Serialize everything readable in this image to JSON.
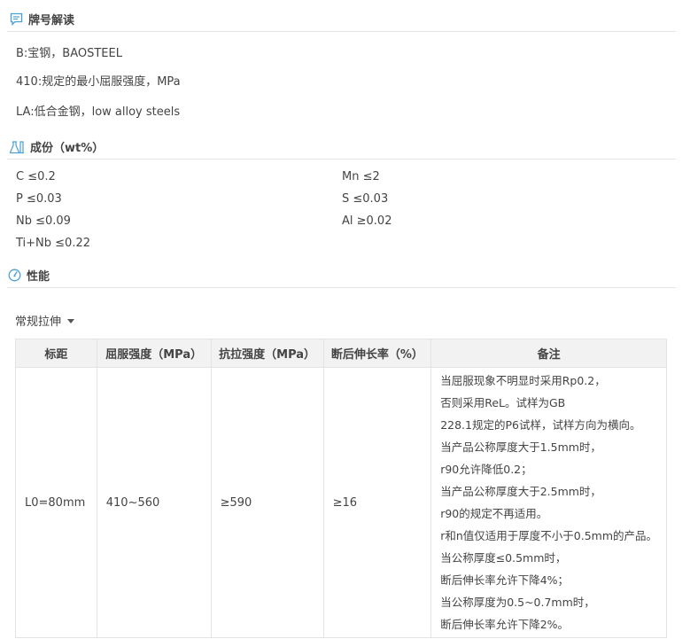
{
  "sections": {
    "designation": {
      "title": "牌号解读",
      "icon": "comment-icon"
    },
    "composition": {
      "title": "成份（wt%）",
      "icon": "flask-icon"
    },
    "properties": {
      "title": "性能",
      "icon": "gauge-icon"
    }
  },
  "designation_lines": [
    "B:宝钢，BAOSTEEL",
    "410:规定的最小屈服强度，MPa",
    "LA:低合金钢，low alloy steels"
  ],
  "composition": {
    "left": [
      "C ≤0.2",
      "P ≤0.03",
      "Nb ≤0.09",
      "Ti+Nb ≤0.22"
    ],
    "right": [
      "Mn ≤2",
      "S ≤0.03",
      "Al ≥0.02"
    ]
  },
  "test_dropdown": {
    "value": "常规拉伸"
  },
  "table": {
    "headers": [
      "标距",
      "屈服强度（MPa）",
      "抗拉强度（MPa）",
      "断后伸长率（%）",
      "备注"
    ],
    "row": {
      "gauge": "L0=80mm",
      "yield": "410~560",
      "tensile": "≥590",
      "elongation": "≥16",
      "notes": [
        "当屈服现象不明显时采用Rp0.2，",
        "否则采用ReL。试样为GB",
        "228.1规定的P6试样，试样方向为横向。",
        "当产品公称厚度大于1.5mm时，",
        "r90允许降低0.2；",
        "当产品公称厚度大于2.5mm时，",
        "r90的规定不再适用。",
        "r和n值仅适用于厚度不小于0.5mm的产品。",
        "当公称厚度≤0.5mm时，",
        "断后伸长率允许下降4%；",
        "当公称厚度为0.5~0.7mm时，",
        "断后伸长率允许下降2%。"
      ]
    }
  },
  "colors": {
    "icon_blue": "#4a9fd5",
    "header_bg": "#f2f2f2",
    "border": "#e3e3e3"
  }
}
